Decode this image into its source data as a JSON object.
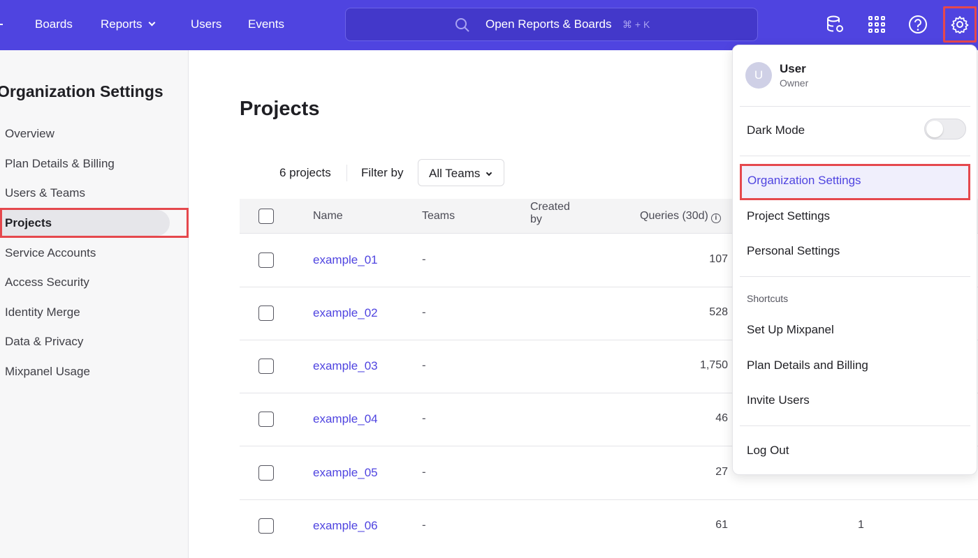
{
  "nav": {
    "links": [
      "Boards",
      "Reports",
      "Users",
      "Events"
    ],
    "search_text": "Open Reports & Boards",
    "search_shortcut": "⌘ + K"
  },
  "sidebar": {
    "title": "Organization Settings",
    "items": [
      {
        "label": "Overview",
        "active": false
      },
      {
        "label": "Plan Details & Billing",
        "active": false
      },
      {
        "label": "Users & Teams",
        "active": false
      },
      {
        "label": "Projects",
        "active": true
      },
      {
        "label": "Service Accounts",
        "active": false
      },
      {
        "label": "Access Security",
        "active": false
      },
      {
        "label": "Identity Merge",
        "active": false
      },
      {
        "label": "Data & Privacy",
        "active": false
      },
      {
        "label": "Mixpanel Usage",
        "active": false
      }
    ]
  },
  "main": {
    "title": "Projects",
    "count_text": "6 projects",
    "filter_label": "Filter by",
    "filter_value": "All Teams",
    "columns": {
      "name": "Name",
      "teams": "Teams",
      "created_by_line1": "Created",
      "created_by_line2": "by",
      "queries": "Queries (30d)"
    },
    "rows": [
      {
        "name": "example_01",
        "teams": "-",
        "queries": "107",
        "extra": ""
      },
      {
        "name": "example_02",
        "teams": "-",
        "queries": "528",
        "extra": ""
      },
      {
        "name": "example_03",
        "teams": "-",
        "queries": "1,750",
        "extra": ""
      },
      {
        "name": "example_04",
        "teams": "-",
        "queries": "46",
        "extra": ""
      },
      {
        "name": "example_05",
        "teams": "-",
        "queries": "27",
        "extra": ""
      },
      {
        "name": "example_06",
        "teams": "-",
        "queries": "61",
        "extra": "1"
      }
    ]
  },
  "menu": {
    "avatar_initial": "U",
    "user_name": "User",
    "user_role": "Owner",
    "dark_mode_label": "Dark Mode",
    "dark_mode_on": false,
    "org_settings": "Organization Settings",
    "project_settings": "Project Settings",
    "personal_settings": "Personal Settings",
    "shortcuts_label": "Shortcuts",
    "setup": "Set Up Mixpanel",
    "plan_billing": "Plan Details and Billing",
    "invite_users": "Invite Users",
    "log_out": "Log Out"
  },
  "colors": {
    "brand": "#4f44e0",
    "highlight": "#e5484d"
  }
}
